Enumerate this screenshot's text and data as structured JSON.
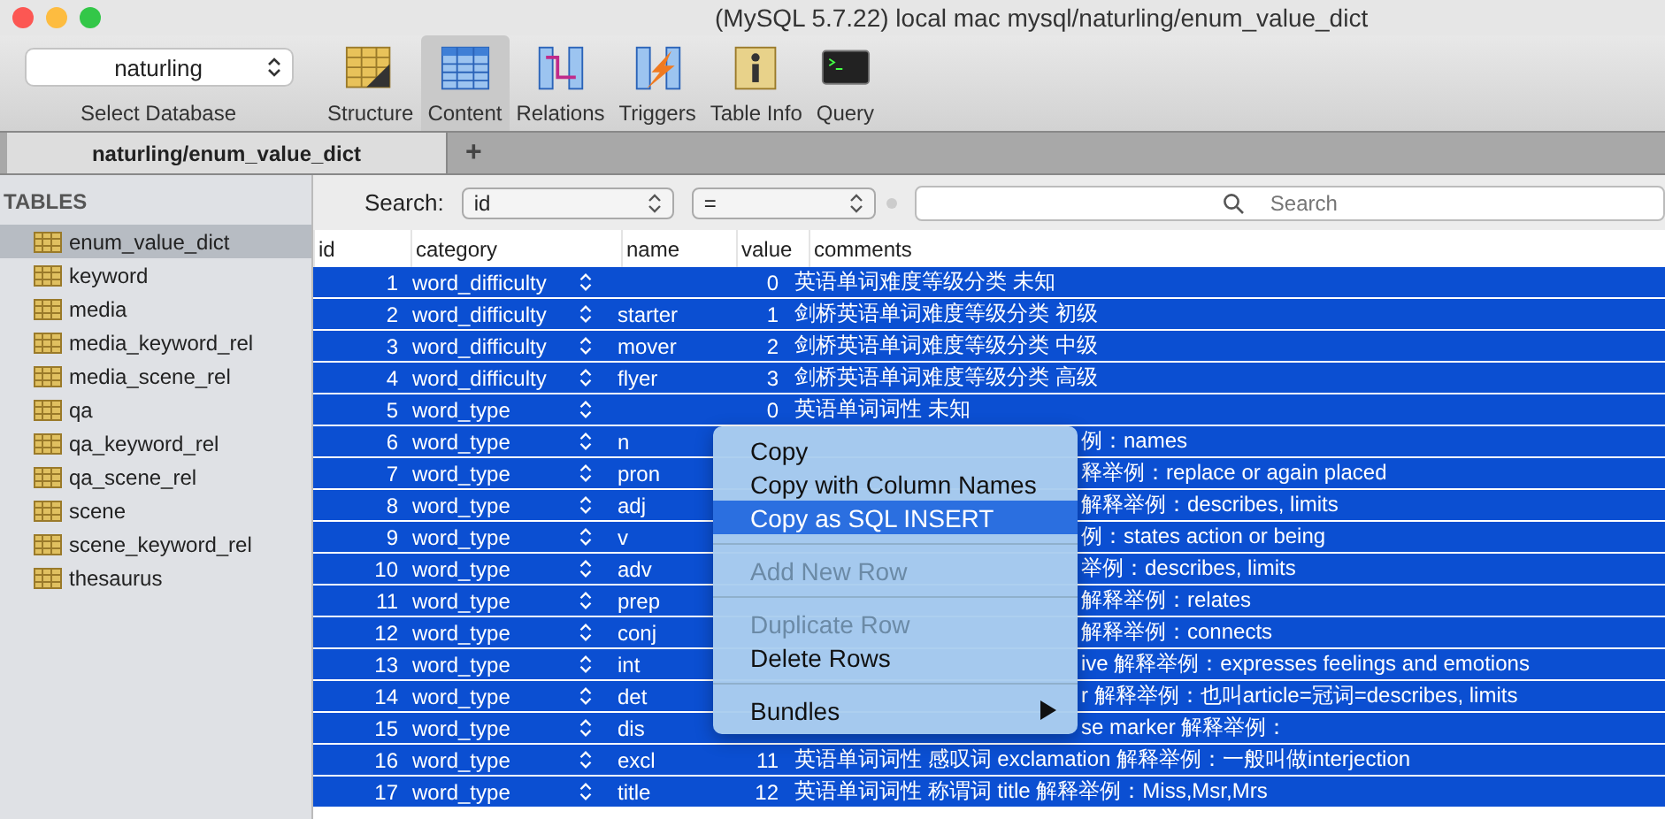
{
  "window": {
    "title": "(MySQL 5.7.22) local mac mysql/naturling/enum_value_dict"
  },
  "database_select": {
    "value": "naturling",
    "label": "Select Database"
  },
  "toolbar": [
    {
      "label": "Structure",
      "kind": "structure",
      "selected": false
    },
    {
      "label": "Content",
      "kind": "content",
      "selected": true
    },
    {
      "label": "Relations",
      "kind": "relations",
      "selected": false
    },
    {
      "label": "Triggers",
      "kind": "triggers",
      "selected": false
    },
    {
      "label": "Table Info",
      "kind": "info",
      "selected": false
    },
    {
      "label": "Query",
      "kind": "query",
      "selected": false
    }
  ],
  "tabs": [
    {
      "label": "naturling/enum_value_dict",
      "selected": true
    }
  ],
  "new_tab": "+",
  "sidebar": {
    "heading": "TABLES",
    "items": [
      {
        "label": "enum_value_dict",
        "selected": true
      },
      {
        "label": "keyword",
        "selected": false
      },
      {
        "label": "media",
        "selected": false
      },
      {
        "label": "media_keyword_rel",
        "selected": false
      },
      {
        "label": "media_scene_rel",
        "selected": false
      },
      {
        "label": "qa",
        "selected": false
      },
      {
        "label": "qa_keyword_rel",
        "selected": false
      },
      {
        "label": "qa_scene_rel",
        "selected": false
      },
      {
        "label": "scene",
        "selected": false
      },
      {
        "label": "scene_keyword_rel",
        "selected": false
      },
      {
        "label": "thesaurus",
        "selected": false
      }
    ]
  },
  "filter": {
    "label": "Search:",
    "field": "id",
    "operator": "=",
    "placeholder": "Search"
  },
  "table": {
    "columns": [
      "id",
      "category",
      "name",
      "value",
      "comments"
    ],
    "rows": [
      {
        "id": "1",
        "category": "word_difficulty",
        "value": "0",
        "comments": "英语单词难度等级分类 未知",
        "selected": true
      },
      {
        "id": "2",
        "category": "word_difficulty",
        "name": "starter",
        "value": "1",
        "comments": "剑桥英语单词难度等级分类 初级",
        "selected": true
      },
      {
        "id": "3",
        "category": "word_difficulty",
        "name": "mover",
        "value": "2",
        "comments": "剑桥英语单词难度等级分类 中级",
        "selected": true
      },
      {
        "id": "4",
        "category": "word_difficulty",
        "name": "flyer",
        "value": "3",
        "comments": "剑桥英语单词难度等级分类 高级",
        "selected": true
      },
      {
        "id": "5",
        "category": "word_type",
        "value": "0",
        "comments": "英语单词词性 未知",
        "selected": true
      },
      {
        "id": "6",
        "category": "word_type",
        "name": "n",
        "comments": "例：names",
        "selected": true
      },
      {
        "id": "7",
        "category": "word_type",
        "name": "pron",
        "comments": "释举例：replace or again placed",
        "selected": true
      },
      {
        "id": "8",
        "category": "word_type",
        "name": "adj",
        "comments": "解释举例：describes, limits",
        "selected": true
      },
      {
        "id": "9",
        "category": "word_type",
        "name": "v",
        "comments": "例：states action or being",
        "selected": true
      },
      {
        "id": "10",
        "category": "word_type",
        "name": "adv",
        "comments": "举例：describes, limits",
        "selected": true
      },
      {
        "id": "11",
        "category": "word_type",
        "name": "prep",
        "comments": "解释举例：relates",
        "selected": true
      },
      {
        "id": "12",
        "category": "word_type",
        "name": "conj",
        "comments": "解释举例：connects",
        "selected": true
      },
      {
        "id": "13",
        "category": "word_type",
        "name": "int",
        "comments": "ive 解释举例：expresses feelings and emotions",
        "selected": true
      },
      {
        "id": "14",
        "category": "word_type",
        "name": "det",
        "comments": "r 解释举例：也叫article=冠词=describes, limits",
        "selected": true
      },
      {
        "id": "15",
        "category": "word_type",
        "name": "dis",
        "comments": "se marker 解释举例：",
        "selected": true
      },
      {
        "id": "16",
        "category": "word_type",
        "name": "excl",
        "value": "11",
        "comments": "英语单词词性 感叹词 exclamation 解释举例：一般叫做interjection",
        "selected": true
      },
      {
        "id": "17",
        "category": "word_type",
        "name": "title",
        "value": "12",
        "comments": "英语单词词性 称谓词 title 解释举例：Miss,Msr,Mrs",
        "selected": true
      }
    ]
  },
  "context_menu": {
    "groups": [
      [
        {
          "label": "Copy",
          "disabled": false,
          "selected": false
        },
        {
          "label": "Copy with Column Names",
          "disabled": false,
          "selected": false
        },
        {
          "label": "Copy as SQL INSERT",
          "disabled": false,
          "selected": true
        }
      ],
      [
        {
          "label": "Add New Row",
          "disabled": true,
          "selected": false
        }
      ],
      [
        {
          "label": "Duplicate Row",
          "disabled": true,
          "selected": false
        },
        {
          "label": "Delete Rows",
          "disabled": false,
          "selected": false
        }
      ],
      [
        {
          "label": "Bundles",
          "disabled": false,
          "selected": false,
          "submenu": true
        }
      ]
    ]
  }
}
